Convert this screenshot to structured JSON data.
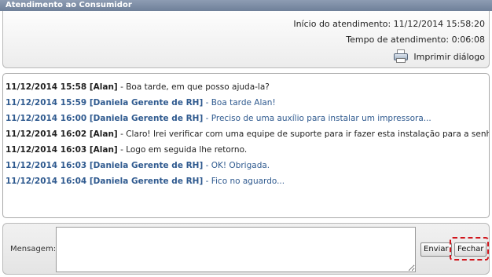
{
  "window": {
    "title": "Atendimento ao Consumidor"
  },
  "info": {
    "start": "Início do atendimento: 11/12/2014 15:58:20",
    "duration": "Tempo de atendimento: 0:06:08",
    "print_label": "Imprimir diálogo",
    "print_icon": "printer-icon"
  },
  "messages": [
    {
      "stamp": "11/12/2014 15:58 [Alan]",
      "text": " - Boa tarde, em que posso ajuda-la?",
      "role": "agent"
    },
    {
      "stamp": "11/12/2014 15:59 [Daniela Gerente de RH]",
      "text": " - Boa tarde Alan!",
      "role": "client"
    },
    {
      "stamp": "11/12/2014 16:00 [Daniela Gerente de RH]",
      "text": " - Preciso de uma auxílio para instalar um impressora...",
      "role": "client"
    },
    {
      "stamp": "11/12/2014 16:02 [Alan]",
      "text": " - Claro! Irei verificar com uma equipe de suporte para ir fazer esta instalação para a senhora...",
      "role": "agent"
    },
    {
      "stamp": "11/12/2014 16:03 [Alan]",
      "text": " - Logo em seguida lhe retorno.",
      "role": "agent"
    },
    {
      "stamp": "11/12/2014 16:03 [Daniela Gerente de RH]",
      "text": " - OK! Obrigada.",
      "role": "client"
    },
    {
      "stamp": "11/12/2014 16:04 [Daniela Gerente de RH]",
      "text": " - Fico no aguardo...",
      "role": "client"
    }
  ],
  "composer": {
    "label": "Mensagem:",
    "value": "",
    "send_label": "Enviar",
    "close_label": "Fechar"
  },
  "colors": {
    "title_bar": "#7a8aa3",
    "agent_text": "#222222",
    "client_text": "#2f5a8f",
    "highlight": "#d0151c"
  }
}
